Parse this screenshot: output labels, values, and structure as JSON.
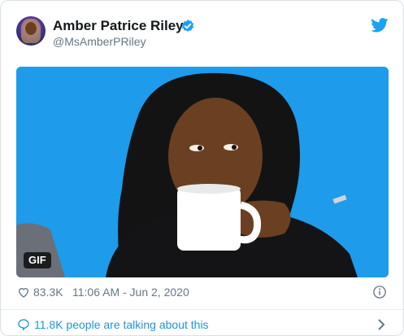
{
  "tweet": {
    "author_name": "Amber Patrice Riley",
    "author_handle": "@MsAmberPRiley",
    "media_badge": "GIF",
    "likes": "83.3K",
    "timestamp": "11:06 AM - Jun 2, 2020",
    "talking": "11.8K people are talking about this"
  },
  "colors": {
    "accent": "#1da1f2",
    "link": "#1b95e0",
    "media_background": "#1e9bea",
    "muted": "#657786"
  },
  "icons": {
    "avatar": "avatar",
    "verified": "verified-badge-icon",
    "platform": "twitter-bird-icon",
    "like": "heart-icon",
    "info": "info-icon",
    "talk": "speech-bubble-icon",
    "more": "chevron-right-icon"
  }
}
